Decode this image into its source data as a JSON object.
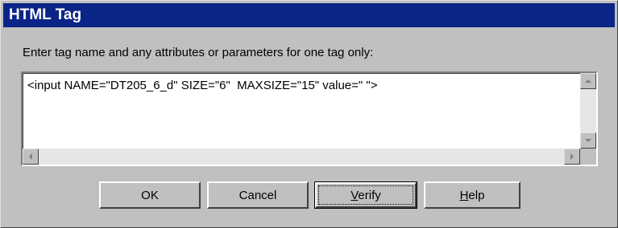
{
  "dialog": {
    "title": "HTML Tag",
    "prompt": "Enter tag name and any attributes or parameters for one tag only:",
    "tag_text": "<input NAME=\"DT205_6_d\" SIZE=\"6\"  MAXSIZE=\"15\" value=\" \">"
  },
  "buttons": {
    "ok": "OK",
    "cancel": "Cancel",
    "verify_underlined": "V",
    "verify_rest": "erify",
    "help_underlined": "H",
    "help_rest": "elp"
  },
  "colors": {
    "title_bar": "#0b2488",
    "dialog_face": "#c0c0c0"
  }
}
